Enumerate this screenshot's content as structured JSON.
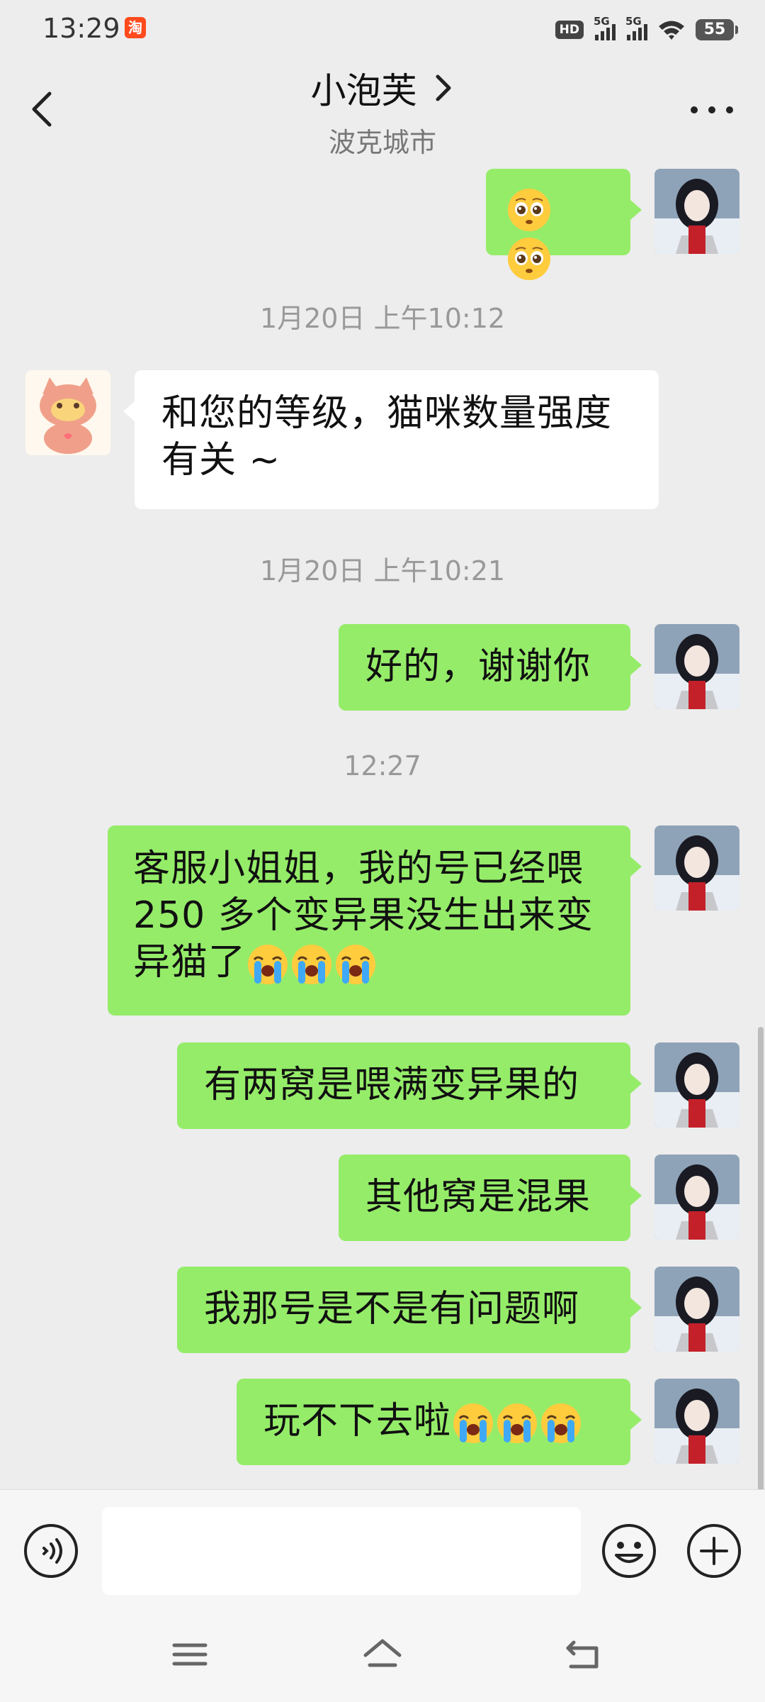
{
  "status_bar": {
    "time": "13:29",
    "taobao_glyph": "淘",
    "hd_label": "HD",
    "sim1_label": "5G",
    "sim2_label": "5G",
    "battery": "55"
  },
  "header": {
    "title": "小泡芙",
    "subtitle": "波克城市"
  },
  "messages": [
    {
      "id": "m1",
      "sender": "me",
      "emojis": [
        "pleading-face",
        "pleading-face"
      ]
    },
    {
      "id": "t1",
      "type": "timestamp",
      "text": "1月20日 上午10:12"
    },
    {
      "id": "m2",
      "sender": "other",
      "lines": [
        "和您的等级，猫咪数量强度",
        "有关 ~"
      ]
    },
    {
      "id": "t2",
      "type": "timestamp",
      "text": "1月20日 上午10:21"
    },
    {
      "id": "m3",
      "sender": "me",
      "text": "好的，谢谢你"
    },
    {
      "id": "t3",
      "type": "timestamp",
      "text": "12:27"
    },
    {
      "id": "m4",
      "sender": "me",
      "lines": [
        "客服小姐姐，我的号已经喂",
        "250 多个变异果没生出来变",
        "异猫了"
      ],
      "emojis": [
        "loudly-crying-face",
        "loudly-crying-face",
        "loudly-crying-face"
      ]
    },
    {
      "id": "m5",
      "sender": "me",
      "text": "有两窝是喂满变异果的"
    },
    {
      "id": "m6",
      "sender": "me",
      "text": "其他窝是混果"
    },
    {
      "id": "m7",
      "sender": "me",
      "text": "我那号是不是有问题啊"
    },
    {
      "id": "m8",
      "sender": "me",
      "text": "玩不下去啦",
      "emojis": [
        "loudly-crying-face",
        "loudly-crying-face",
        "loudly-crying-face"
      ]
    }
  ],
  "input": {
    "placeholder": "",
    "value": ""
  },
  "colors": {
    "my_bubble": "#95ec69",
    "other_bubble": "#ffffff",
    "background": "#ededed"
  }
}
